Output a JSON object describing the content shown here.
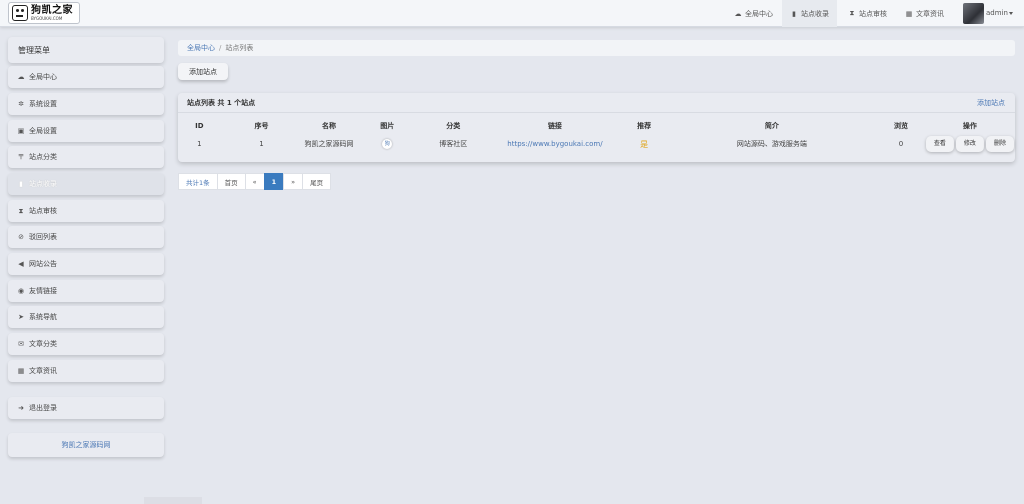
{
  "header": {
    "logo_name": "狗凯之家",
    "logo_url": "BYGOUKAI.COM",
    "nav": [
      {
        "label": "全局中心",
        "icon": "dashboard-icon"
      },
      {
        "label": "站点收录",
        "icon": "book-icon"
      },
      {
        "label": "站点审核",
        "icon": "hourglass-icon"
      },
      {
        "label": "文章资讯",
        "icon": "keyboard-icon"
      }
    ],
    "user": "admin"
  },
  "sidebar": {
    "title": "管理菜单",
    "items": [
      {
        "label": "全局中心",
        "icon": "dashboard-icon"
      },
      {
        "label": "系统设置",
        "icon": "gear-icon"
      },
      {
        "label": "全局设置",
        "icon": "picture-icon"
      },
      {
        "label": "站点分类",
        "icon": "filter-icon"
      },
      {
        "label": "站点收录",
        "icon": "book-icon"
      },
      {
        "label": "站点审核",
        "icon": "hourglass-icon"
      },
      {
        "label": "驳回列表",
        "icon": "ban-icon"
      },
      {
        "label": "网站公告",
        "icon": "bullhorn-icon"
      },
      {
        "label": "友情链接",
        "icon": "eye-icon"
      },
      {
        "label": "系统导航",
        "icon": "send-icon"
      },
      {
        "label": "文章分类",
        "icon": "envelope-icon"
      },
      {
        "label": "文章资讯",
        "icon": "keyboard-icon"
      }
    ],
    "logout": "退出登录",
    "site_link": "狗凯之家源码网"
  },
  "breadcrumb": {
    "home": "全局中心",
    "separator": "/",
    "current": "站点列表"
  },
  "toolbar": {
    "add_label": "添加站点"
  },
  "panel": {
    "title": "站点列表 共 1 个站点",
    "add_link": "添加站点",
    "columns": [
      "ID",
      "序号",
      "名称",
      "图片",
      "分类",
      "链接",
      "推荐",
      "简介",
      "浏览",
      "操作"
    ],
    "rows": [
      {
        "id": "1",
        "order": "1",
        "name": "狗凯之家源码网",
        "image": "狗",
        "category": "博客社区",
        "link": "https://www.bygoukai.com/",
        "recommend": "是",
        "intro": "网站源码、游戏服务端",
        "views": "0",
        "actions": [
          "查看",
          "修改",
          "删除"
        ]
      }
    ]
  },
  "pagination": {
    "info": "共计1条",
    "first": "首页",
    "prev": "«",
    "current": "1",
    "next": "»",
    "last": "尾页"
  },
  "colors": {
    "accent": "#3a7bbf",
    "link": "#4a77b4",
    "star": "#e0a51a"
  }
}
